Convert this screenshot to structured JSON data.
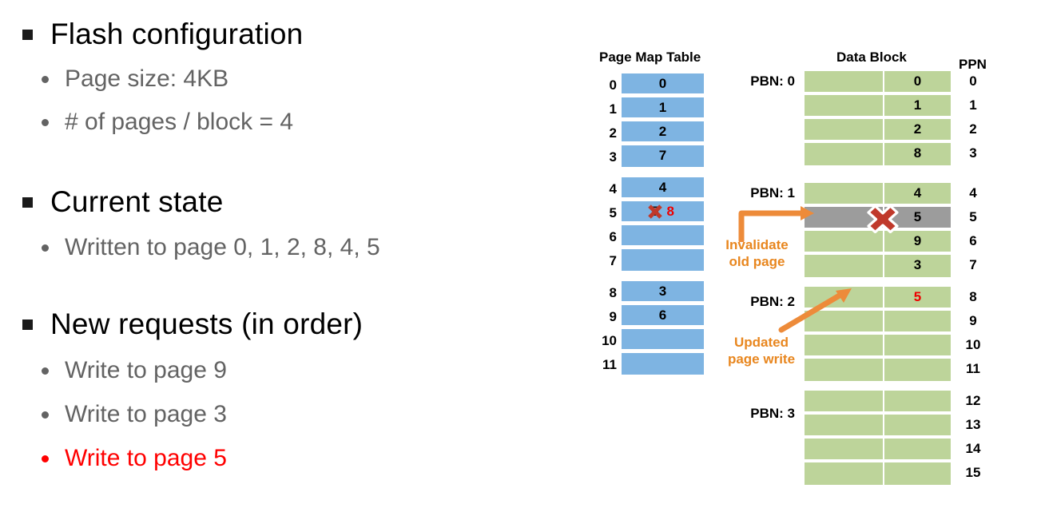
{
  "slide": {
    "title_bullets": [
      {
        "label": "Flash configuration"
      },
      {
        "label": "Current state"
      },
      {
        "label": "New requests (in order)"
      }
    ],
    "sub_bullets": [
      {
        "label": "Page size: 4KB",
        "color": "gray"
      },
      {
        "label": "# of pages / block = 4",
        "color": "gray"
      },
      {
        "label": "Written to page 0, 1, 2, 8, 4, 5",
        "color": "gray"
      },
      {
        "label": "Write to page 9",
        "color": "gray"
      },
      {
        "label": "Write to page 3",
        "color": "gray"
      },
      {
        "label": "Write to page 5",
        "color": "red"
      }
    ]
  },
  "diagram": {
    "headers": {
      "page_map_table": "Page Map Table",
      "data_block": "Data Block",
      "ppn": "PPN"
    },
    "page_map_table": {
      "indices": [
        "0",
        "1",
        "2",
        "3",
        "4",
        "5",
        "6",
        "7",
        "8",
        "9",
        "10",
        "11"
      ],
      "values": [
        "0",
        "1",
        "2",
        "7",
        "4",
        "",
        "",
        "",
        "3",
        "6",
        "",
        ""
      ],
      "row5_old_value": "5",
      "row5_new_value": "8"
    },
    "data_block": {
      "pbn_labels": [
        "PBN: 0",
        "PBN: 1",
        "PBN: 2",
        "PBN: 3"
      ],
      "ppn_indices": [
        "0",
        "1",
        "2",
        "3",
        "4",
        "5",
        "6",
        "7",
        "8",
        "9",
        "10",
        "11",
        "12",
        "13",
        "14",
        "15"
      ],
      "page_values": [
        "0",
        "1",
        "2",
        "8",
        "4",
        "5",
        "9",
        "3",
        "5",
        "",
        "",
        "",
        "",
        "",
        "",
        ""
      ],
      "invalid_ppn": "5",
      "new_write_ppn": "8"
    },
    "annotations": [
      {
        "line1": "Invalidate",
        "line2": "old page"
      },
      {
        "line1": "Updated",
        "line2": "page write"
      }
    ],
    "colors": {
      "page_map_cell": "#7EB4E2",
      "data_block_cell": "#BDD49A",
      "invalid_row": "#9C9C9C",
      "annotation": "#E8861E",
      "highlight_red": "#EE0000"
    }
  }
}
